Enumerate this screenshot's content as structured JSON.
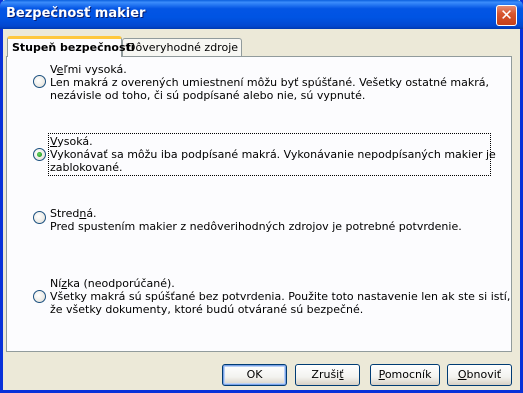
{
  "window": {
    "title": "Bezpečnosť makier"
  },
  "tabs": [
    {
      "label": "Stupeň bezpečnosti"
    },
    {
      "label": "Dôveryhodné zdroje"
    }
  ],
  "options": [
    {
      "title_pre": "V",
      "title_ul": "e",
      "title_post": "ľmi vysoká.",
      "line1": "Len makrá z overených umiestnení môžu byť spúšťané. Vešetky ostatné makrá,",
      "line2": "nezávisle od toho, či sú podpísané alebo nie, sú vypnuté.",
      "selected": false
    },
    {
      "title_pre": "",
      "title_ul": "V",
      "title_post": "ysoká.",
      "line1": "Vykonávať sa môžu iba podpísané makrá. Vykonávanie nepodpísaných makier je",
      "line2": "zablokované.",
      "selected": true
    },
    {
      "title_pre": "Stred",
      "title_ul": "n",
      "title_post": "á.",
      "line1": "Pred spustením makier z nedôverihodných zdrojov je potrebné potvrdenie.",
      "line2": "",
      "selected": false
    },
    {
      "title_pre": "Ní",
      "title_ul": "z",
      "title_post": "ka (neodporúčané).",
      "line1": "Všetky makrá sú spúšťané bez potvrdenia. Použite toto nastavenie len ak ste si istí,",
      "line2": "že všetky dokumenty, ktoré budú otvárané sú bezpečné.",
      "selected": false
    }
  ],
  "buttons": {
    "ok": {
      "pre": "OK",
      "ul": "",
      "post": ""
    },
    "cancel": {
      "pre": "Zruši",
      "ul": "ť",
      "post": ""
    },
    "help": {
      "pre": "",
      "ul": "P",
      "post": "omocník"
    },
    "reset": {
      "pre": "",
      "ul": "O",
      "post": "bnoviť"
    }
  }
}
